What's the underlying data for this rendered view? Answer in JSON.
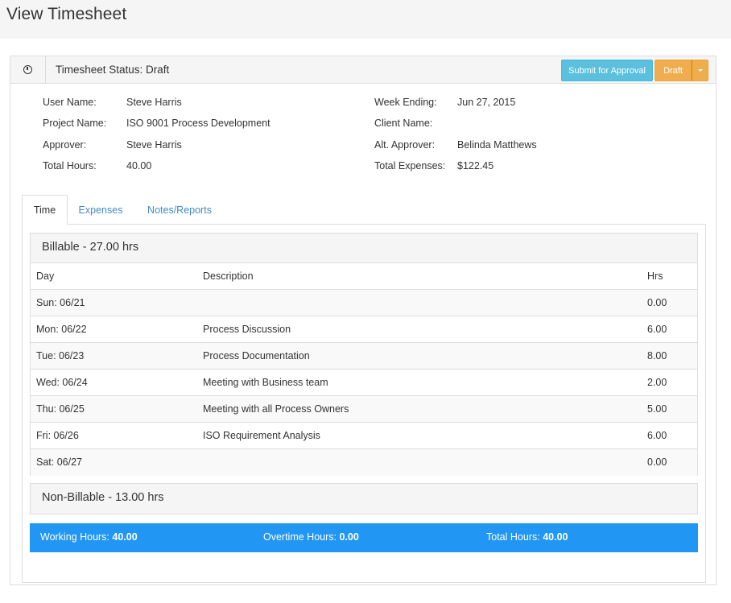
{
  "page": {
    "title": "View Timesheet"
  },
  "status": {
    "text": "Timesheet Status: Draft",
    "submit_label": "Submit for Approval",
    "draft_label": "Draft"
  },
  "info": {
    "user_name_label": "User Name:",
    "user_name": "Steve Harris",
    "project_name_label": "Project Name:",
    "project_name": "ISO 9001 Process Development",
    "approver_label": "Approver:",
    "approver": "Steve Harris",
    "total_hours_label": "Total Hours:",
    "total_hours": "40.00",
    "week_ending_label": "Week Ending:",
    "week_ending": "Jun 27, 2015",
    "client_name_label": "Client Name:",
    "client_name": "",
    "alt_approver_label": "Alt. Approver:",
    "alt_approver": "Belinda Matthews",
    "total_expenses_label": "Total Expenses:",
    "total_expenses": "$122.45"
  },
  "tabs": [
    {
      "label": "Time"
    },
    {
      "label": "Expenses"
    },
    {
      "label": "Notes/Reports"
    }
  ],
  "billable": {
    "title": "Billable - 27.00 hrs",
    "columns": {
      "day": "Day",
      "description": "Description",
      "hrs": "Hrs"
    },
    "rows": [
      {
        "day": "Sun: 06/21",
        "description": "",
        "hrs": "0.00"
      },
      {
        "day": "Mon: 06/22",
        "description": "Process Discussion",
        "hrs": "6.00"
      },
      {
        "day": "Tue: 06/23",
        "description": "Process Documentation",
        "hrs": "8.00"
      },
      {
        "day": "Wed: 06/24",
        "description": "Meeting with Business team",
        "hrs": "2.00"
      },
      {
        "day": "Thu: 06/25",
        "description": "Meeting with all Process Owners",
        "hrs": "5.00"
      },
      {
        "day": "Fri: 06/26",
        "description": "ISO Requirement Analysis",
        "hrs": "6.00"
      },
      {
        "day": "Sat: 06/27",
        "description": "",
        "hrs": "0.00"
      }
    ]
  },
  "non_billable": {
    "title": "Non-Billable - 13.00 hrs"
  },
  "summary": {
    "working_label": "Working Hours:",
    "working_value": "40.00",
    "overtime_label": "Overtime Hours:",
    "overtime_value": "0.00",
    "total_label": "Total Hours:",
    "total_value": "40.00"
  },
  "colors": {
    "accent": "#2196f3",
    "info_button": "#5bc0de",
    "warning_button": "#f0ad4e",
    "link": "#428bca"
  }
}
